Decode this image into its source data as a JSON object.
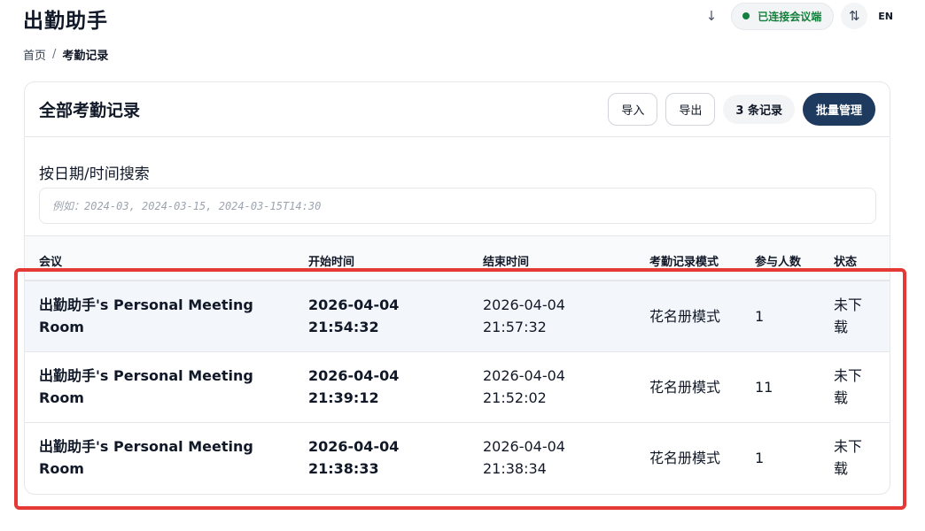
{
  "app": {
    "title": "出勤助手"
  },
  "topbar": {
    "download_icon": "↓",
    "status_text": "已连接会议端",
    "status_color": "#15803d",
    "swap_icon": "⇅",
    "lang_label": "EN"
  },
  "breadcrumb": {
    "home": "首页",
    "separator": "/",
    "current": "考勤记录"
  },
  "card": {
    "title": "全部考勤记录",
    "import_label": "导入",
    "export_label": "导出",
    "record_count": "3 条记录",
    "batch_label": "批量管理",
    "accent_color": "#1e3a5f"
  },
  "search": {
    "label": "按日期/时间搜索",
    "placeholder": "例如：2024-03, 2024-03-15, 2024-03-15T14:30",
    "value": ""
  },
  "table": {
    "columns": [
      "会议",
      "开始时间",
      "结束时间",
      "考勤记录模式",
      "参与人数",
      "状态"
    ],
    "rows": [
      {
        "meeting_line1": "出勤助手's Personal Meeting",
        "meeting_line2": "Room",
        "start_date": "2026-04-04",
        "start_time": "21:54:32",
        "end_date": "2026-04-04",
        "end_time": "21:57:32",
        "mode": "花名册模式",
        "participants": "1",
        "status_line1": "未下",
        "status_line2": "载"
      },
      {
        "meeting_line1": "出勤助手's Personal Meeting",
        "meeting_line2": "Room",
        "start_date": "2026-04-04",
        "start_time": "21:39:12",
        "end_date": "2026-04-04",
        "end_time": "21:52:02",
        "mode": "花名册模式",
        "participants": "11",
        "status_line1": "未下",
        "status_line2": "载"
      },
      {
        "meeting_line1": "出勤助手's Personal Meeting",
        "meeting_line2": "Room",
        "start_date": "2026-04-04",
        "start_time": "21:38:33",
        "end_date": "2026-04-04",
        "end_time": "21:38:34",
        "mode": "花名册模式",
        "participants": "1",
        "status_line1": "未下",
        "status_line2": "载"
      }
    ]
  },
  "highlight_color": "#e53935"
}
